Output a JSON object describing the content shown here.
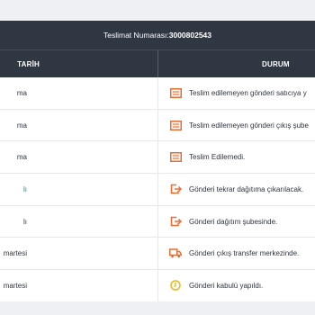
{
  "header": {
    "tracking_label": "Teslimat Numarası:",
    "tracking_number": "3000802543"
  },
  "columns": {
    "date": "TARİH",
    "status": "DURUM"
  },
  "colors": {
    "orange": "#ee6b2f",
    "yellow": "#f2b51d",
    "dark": "#2f3742"
  },
  "rows": [
    {
      "date": "ma",
      "status": "Teslim edilemeyen gönderi satıcıya y",
      "icon": "document-icon"
    },
    {
      "date": "ma",
      "status": "Teslim edilemeyen gönderi çıkış şube",
      "icon": "document-icon"
    },
    {
      "date": "ma",
      "status": "Teslim Edilemedi.",
      "icon": "document-icon"
    },
    {
      "date": "lı",
      "status": "Gönderi tekrar dağıtıma çıkarılacak.",
      "icon": "redirect-icon"
    },
    {
      "date": "lı",
      "status": "Gönderi dağıtım şubesinde.",
      "icon": "redirect-icon"
    },
    {
      "date": "martesi",
      "status": "Gönderi çıkış transfer merkezinde.",
      "icon": "truck-icon"
    },
    {
      "date": "martesi",
      "status": "Gönderi kabulü yapıldı.",
      "icon": "clock-icon"
    }
  ]
}
